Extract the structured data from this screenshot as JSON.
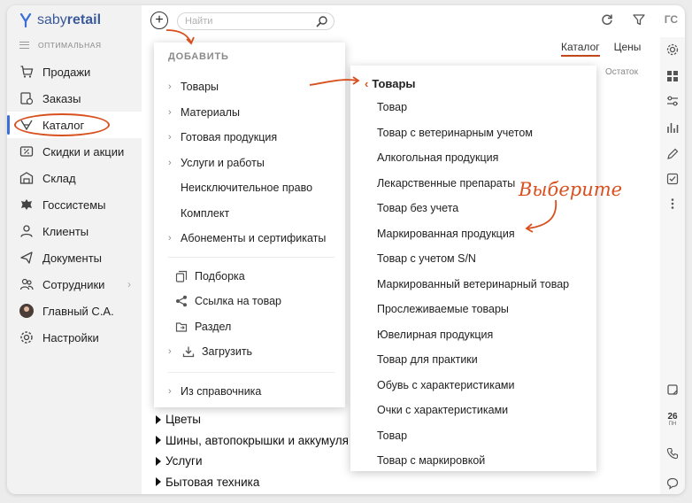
{
  "app": {
    "logo_text_light": "saby",
    "logo_text_bold": "retail",
    "plan": "ОПТИМАЛЬНАЯ"
  },
  "sidebar": {
    "items": [
      {
        "label": "Продажи",
        "icon": "cart-icon"
      },
      {
        "label": "Заказы",
        "icon": "orders-icon"
      },
      {
        "label": "Каталог",
        "icon": "catalog-icon",
        "active": true
      },
      {
        "label": "Скидки и акции",
        "icon": "percent-icon"
      },
      {
        "label": "Склад",
        "icon": "warehouse-icon"
      },
      {
        "label": "Госсистемы",
        "icon": "emblem-icon"
      },
      {
        "label": "Клиенты",
        "icon": "clients-icon"
      },
      {
        "label": "Документы",
        "icon": "documents-icon"
      },
      {
        "label": "Сотрудники",
        "icon": "employees-icon"
      },
      {
        "label": "Главный С.А.",
        "icon": "avatar"
      },
      {
        "label": "Настройки",
        "icon": "gear-icon"
      }
    ]
  },
  "search": {
    "placeholder": "Найти"
  },
  "topbar": {
    "user_initials": "ГС"
  },
  "tabs": [
    {
      "label": "Каталог",
      "active": true
    },
    {
      "label": "Цены"
    }
  ],
  "column": {
    "ostatok": "Остаток"
  },
  "rightbar": {
    "date_day": "26",
    "date_weekday": "ПН"
  },
  "add_menu": {
    "header": "ДОБАВИТЬ",
    "items": [
      {
        "label": "Товары",
        "arrow": true
      },
      {
        "label": "Материалы",
        "arrow": true
      },
      {
        "label": "Готовая продукция",
        "arrow": true
      },
      {
        "label": "Услуги и работы",
        "arrow": true
      },
      {
        "label": "Неисключительное право",
        "arrow": false
      },
      {
        "label": "Комплект",
        "arrow": false
      },
      {
        "label": "Абонементы и сертификаты",
        "arrow": true
      }
    ],
    "tools": [
      {
        "label": "Подборка",
        "icon": "collection-icon"
      },
      {
        "label": "Ссылка на товар",
        "icon": "share-icon"
      },
      {
        "label": "Раздел",
        "icon": "folder-icon"
      },
      {
        "label": "Загрузить",
        "icon": "upload-icon"
      }
    ],
    "footer": "Из справочника"
  },
  "goods_menu": {
    "title": "Товары",
    "items": [
      "Товар",
      "Товар с ветеринарным учетом",
      "Алкогольная продукция",
      "Лекарственные препараты",
      "Товар без учета",
      "Маркированная продукция",
      "Товар с учетом S/N",
      "Маркированный ветеринарный товар",
      "Прослеживаемые товары",
      "Ювелирная продукция",
      "Товар для практики",
      "Обувь с характеристиками",
      "Очки с характеристиками",
      "Товар",
      "Товар с маркировкой"
    ]
  },
  "catalog_list": [
    "Цветы",
    "Шины, автопокрышки и аккумуля",
    "Услуги",
    "Бытовая техника"
  ],
  "annotation": {
    "text": "Выберите"
  },
  "colors": {
    "accent": "#d8501e",
    "brand": "#3a5a9a",
    "active_bar": "#3a6fd8"
  }
}
